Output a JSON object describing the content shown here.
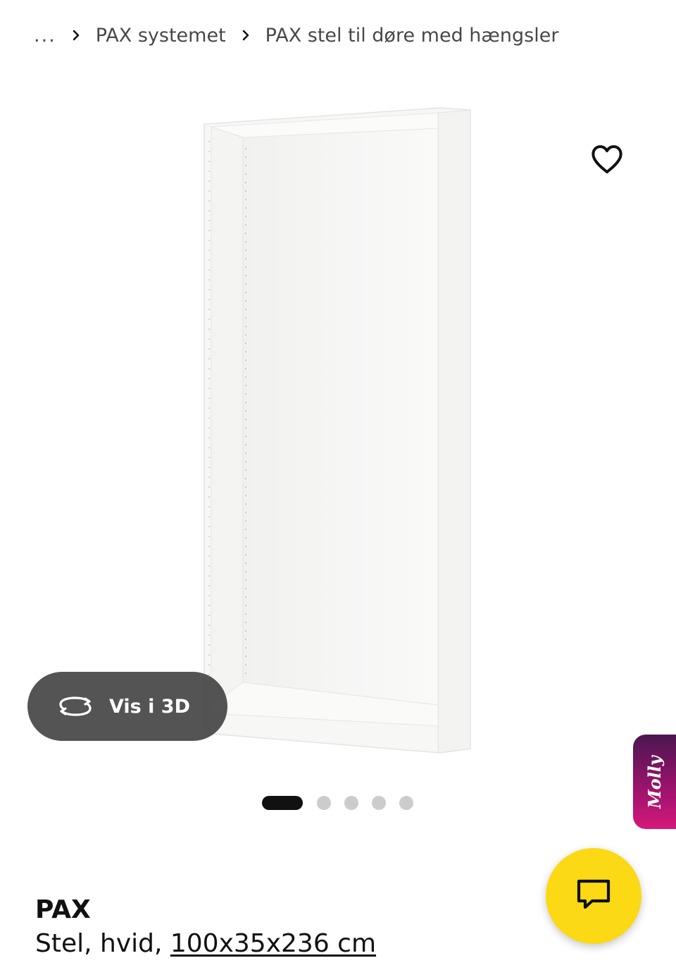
{
  "breadcrumb": {
    "ellipsis": "...",
    "items": [
      {
        "label": "PAX systemet"
      },
      {
        "label": "PAX stel til døre med hængsler"
      }
    ]
  },
  "gallery": {
    "view_3d_label": "Vis i 3D",
    "active_image": 1,
    "image_count": 5
  },
  "molly": {
    "label": "Molly"
  },
  "product": {
    "name": "PAX",
    "description": "Stel, hvid,",
    "dimensions": "100x35x236 cm"
  },
  "colors": {
    "chat_button": "#fbd914",
    "view_3d_button": "#3c3c3c",
    "active_dot": "#111111",
    "inactive_dot": "#cccccc",
    "molly_gradient_top": "#4a1650",
    "molly_gradient_bottom": "#d6187a"
  },
  "icons": {
    "separator": "chevron-right-icon",
    "favorite": "heart-outline-icon",
    "view_3d": "rotate-3d-icon",
    "chat": "chat-bubble-icon"
  }
}
